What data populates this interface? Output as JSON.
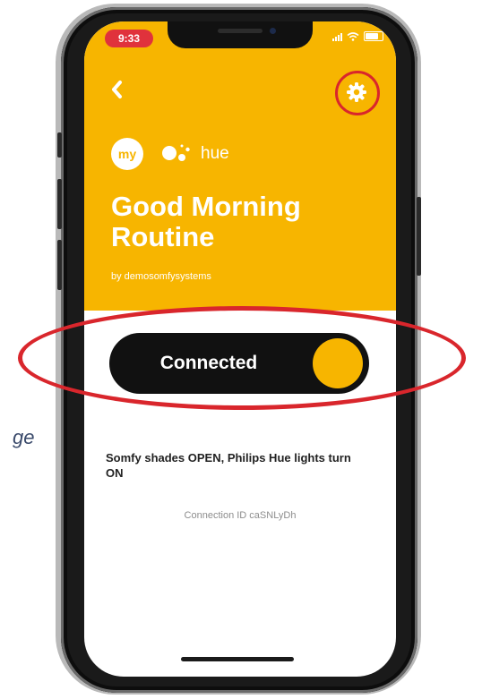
{
  "background_text": "ge",
  "status_bar": {
    "time": "9:33"
  },
  "header": {
    "back_icon": "chevron-left-icon",
    "settings_icon": "gear-icon",
    "services": {
      "my_logo": "my",
      "assistant_icon": "google-assistant-icon",
      "hue_logo": "hue"
    },
    "title": "Good Morning Routine",
    "byline": "by demosomfysystems"
  },
  "toggle": {
    "label": "Connected",
    "state": "on"
  },
  "description": "Somfy shades OPEN, Philips Hue lights turn ON",
  "connection_id": "Connection ID caSNLyDh",
  "colors": {
    "accent": "#f7b500",
    "annotation_red": "#d9262c",
    "toggle_bg": "#111111"
  }
}
